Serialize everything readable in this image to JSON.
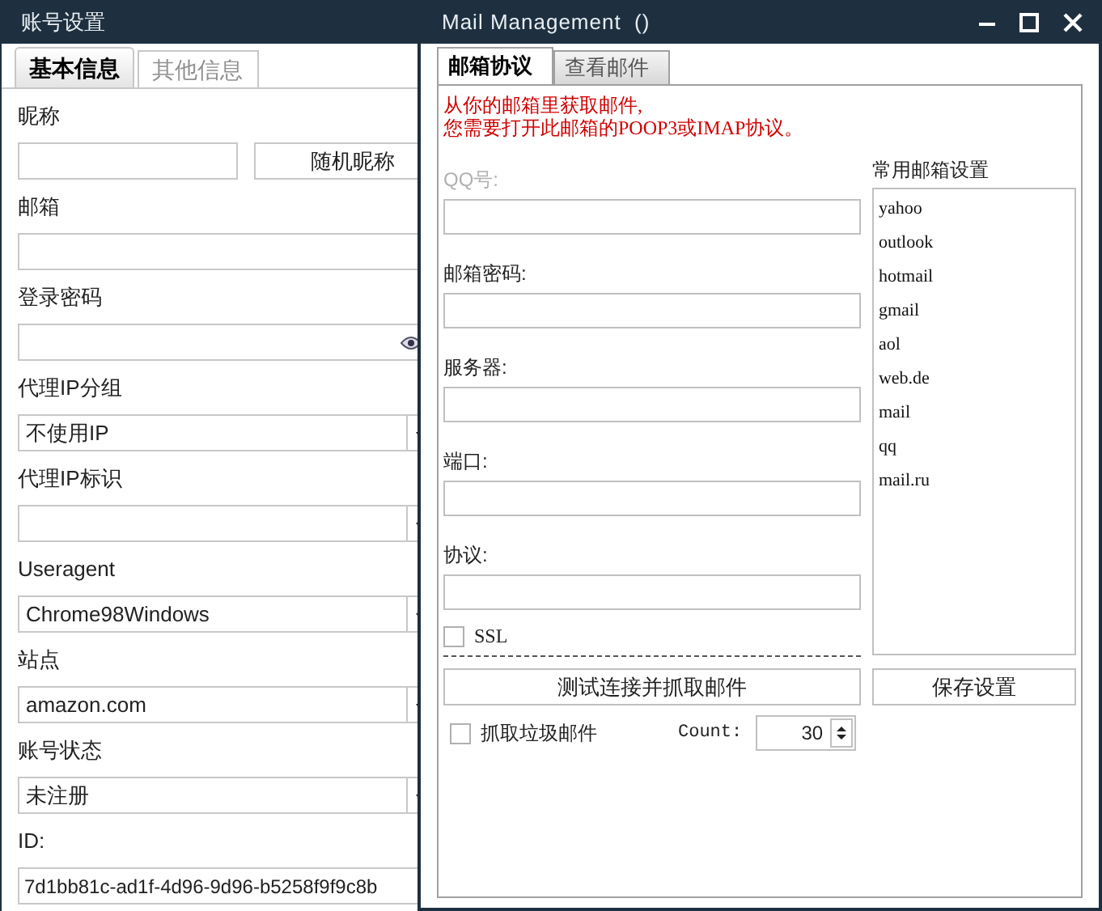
{
  "account_window": {
    "title": "账号设置",
    "tabs": [
      {
        "label": "基本信息",
        "selected": true
      },
      {
        "label": "其他信息",
        "selected": false
      }
    ],
    "fields": [
      {
        "kind": "text_button",
        "label": "昵称",
        "button": "随机昵称"
      },
      {
        "kind": "text",
        "label": "邮箱"
      },
      {
        "kind": "password",
        "label": "登录密码"
      },
      {
        "kind": "select",
        "label": "代理IP分组",
        "value": "不使用IP"
      },
      {
        "kind": "select",
        "label": "代理IP标识"
      },
      {
        "kind": "select",
        "label": "Useragent",
        "value": "Chrome98Windows"
      },
      {
        "kind": "select",
        "label": "站点",
        "value": "amazon.com"
      },
      {
        "kind": "select",
        "label": "账号状态",
        "value": "未注册"
      },
      {
        "kind": "text",
        "label": "ID:",
        "value": "7d1bb81c-ad1f-4d96-9d96-b5258f9f9c8b"
      }
    ]
  },
  "mail_window": {
    "title": "Mail Management  ()",
    "tabs": [
      {
        "label": "邮箱协议",
        "selected": true
      },
      {
        "label": "查看邮件",
        "selected": false
      }
    ],
    "notice": [
      "从你的邮箱里获取邮件,",
      "您需要打开此邮箱的POOP3或IMAP协议。"
    ],
    "fields": [
      {
        "label": "QQ号:",
        "disabled": true
      },
      {
        "label": "邮箱密码:",
        "disabled": false
      },
      {
        "label": "服务器:",
        "disabled": false
      },
      {
        "label": "端口:",
        "disabled": false
      },
      {
        "label": "协议:",
        "disabled": false
      }
    ],
    "ssl": {
      "label": "SSL",
      "checked": false
    },
    "test_button": "测试连接并抓取邮件",
    "providers": {
      "title": "常用邮箱设置",
      "items": [
        "yahoo",
        "outlook",
        "hotmail",
        "gmail",
        "aol",
        "web.de",
        "mail",
        "qq",
        "mail.ru"
      ]
    },
    "save_button": "保存设置",
    "junk": {
      "label": "抓取垃圾邮件",
      "checked": false
    },
    "count": {
      "label": "Count:",
      "value": "30"
    }
  }
}
